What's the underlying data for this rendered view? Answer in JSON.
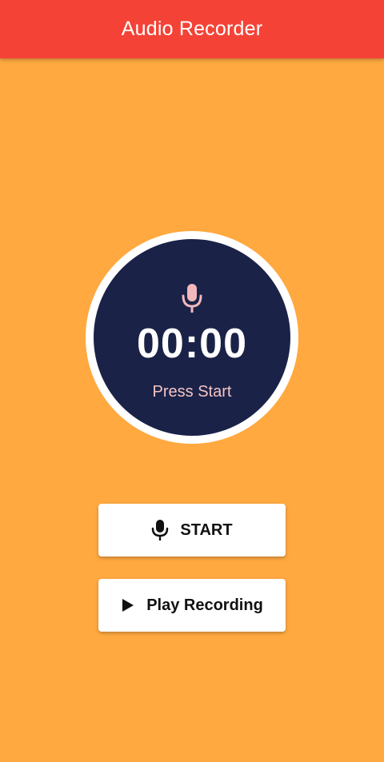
{
  "app_bar": {
    "title": "Audio Recorder",
    "color": "#F44336"
  },
  "background_color": "#FFA940",
  "timer": {
    "icon": "microphone-icon",
    "time": "00:00",
    "status": "Press Start",
    "disc_color": "#1A2248",
    "ring_color": "#FFFFFF",
    "status_color": "#F5C4C4"
  },
  "buttons": {
    "start": {
      "label": "START",
      "icon": "microphone-icon"
    },
    "play": {
      "label": "Play Recording",
      "icon": "play-icon"
    }
  }
}
